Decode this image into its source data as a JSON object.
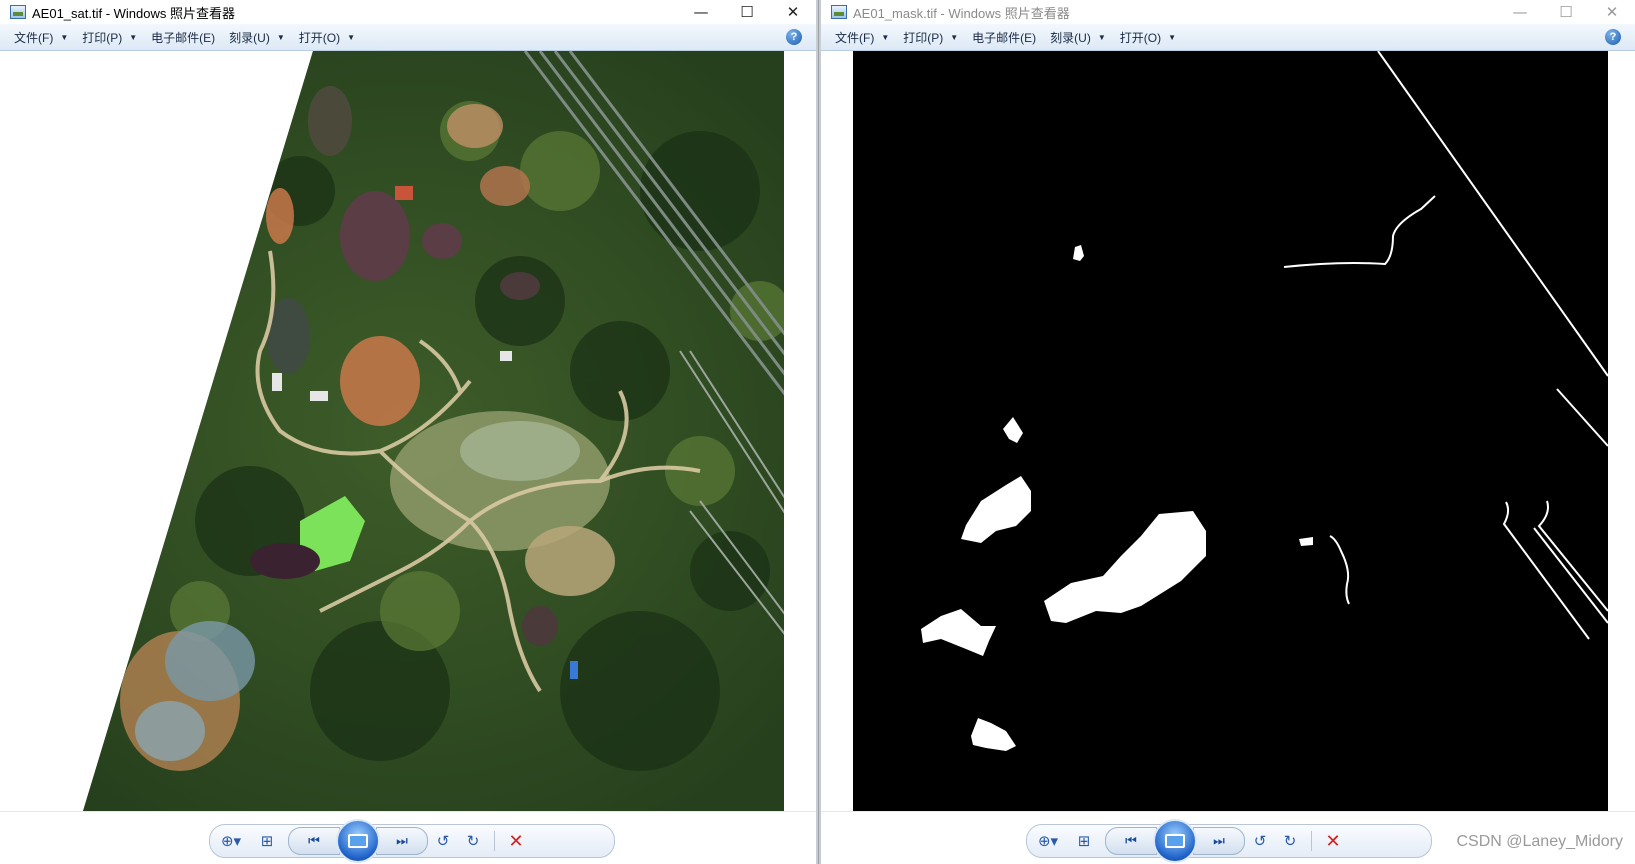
{
  "left_window": {
    "title": "AE01_sat.tif - Windows 照片查看器",
    "menu": [
      {
        "label": "文件(F)",
        "has_dropdown": true
      },
      {
        "label": "打印(P)",
        "has_dropdown": true
      },
      {
        "label": "电子邮件(E)",
        "has_dropdown": false
      },
      {
        "label": "刻录(U)",
        "has_dropdown": true
      },
      {
        "label": "打开(O)",
        "has_dropdown": true
      }
    ],
    "help_label": "?"
  },
  "right_window": {
    "title": "AE01_mask.tif - Windows 照片查看器",
    "menu": [
      {
        "label": "文件(F)",
        "has_dropdown": true
      },
      {
        "label": "打印(P)",
        "has_dropdown": true
      },
      {
        "label": "电子邮件(E)",
        "has_dropdown": false
      },
      {
        "label": "刻录(U)",
        "has_dropdown": true
      },
      {
        "label": "打开(O)",
        "has_dropdown": true
      }
    ],
    "help_label": "?"
  },
  "window_controls": {
    "minimize": "—",
    "maximize": "☐",
    "close": "✕"
  },
  "toolbar_icons": [
    "zoom-icon",
    "fit-window-icon",
    "previous-icon",
    "slideshow-icon",
    "next-icon",
    "rotate-counterclockwise-icon",
    "rotate-clockwise-icon",
    "delete-icon"
  ],
  "colors": {
    "menubar_top": "#f3f8fd",
    "menubar_bottom": "#dde9f6",
    "accent": "#1f62c9",
    "delete": "#d21f1f",
    "mask_bg": "#000000",
    "mask_fg": "#ffffff"
  },
  "watermark": "CSDN @Laney_Midory"
}
